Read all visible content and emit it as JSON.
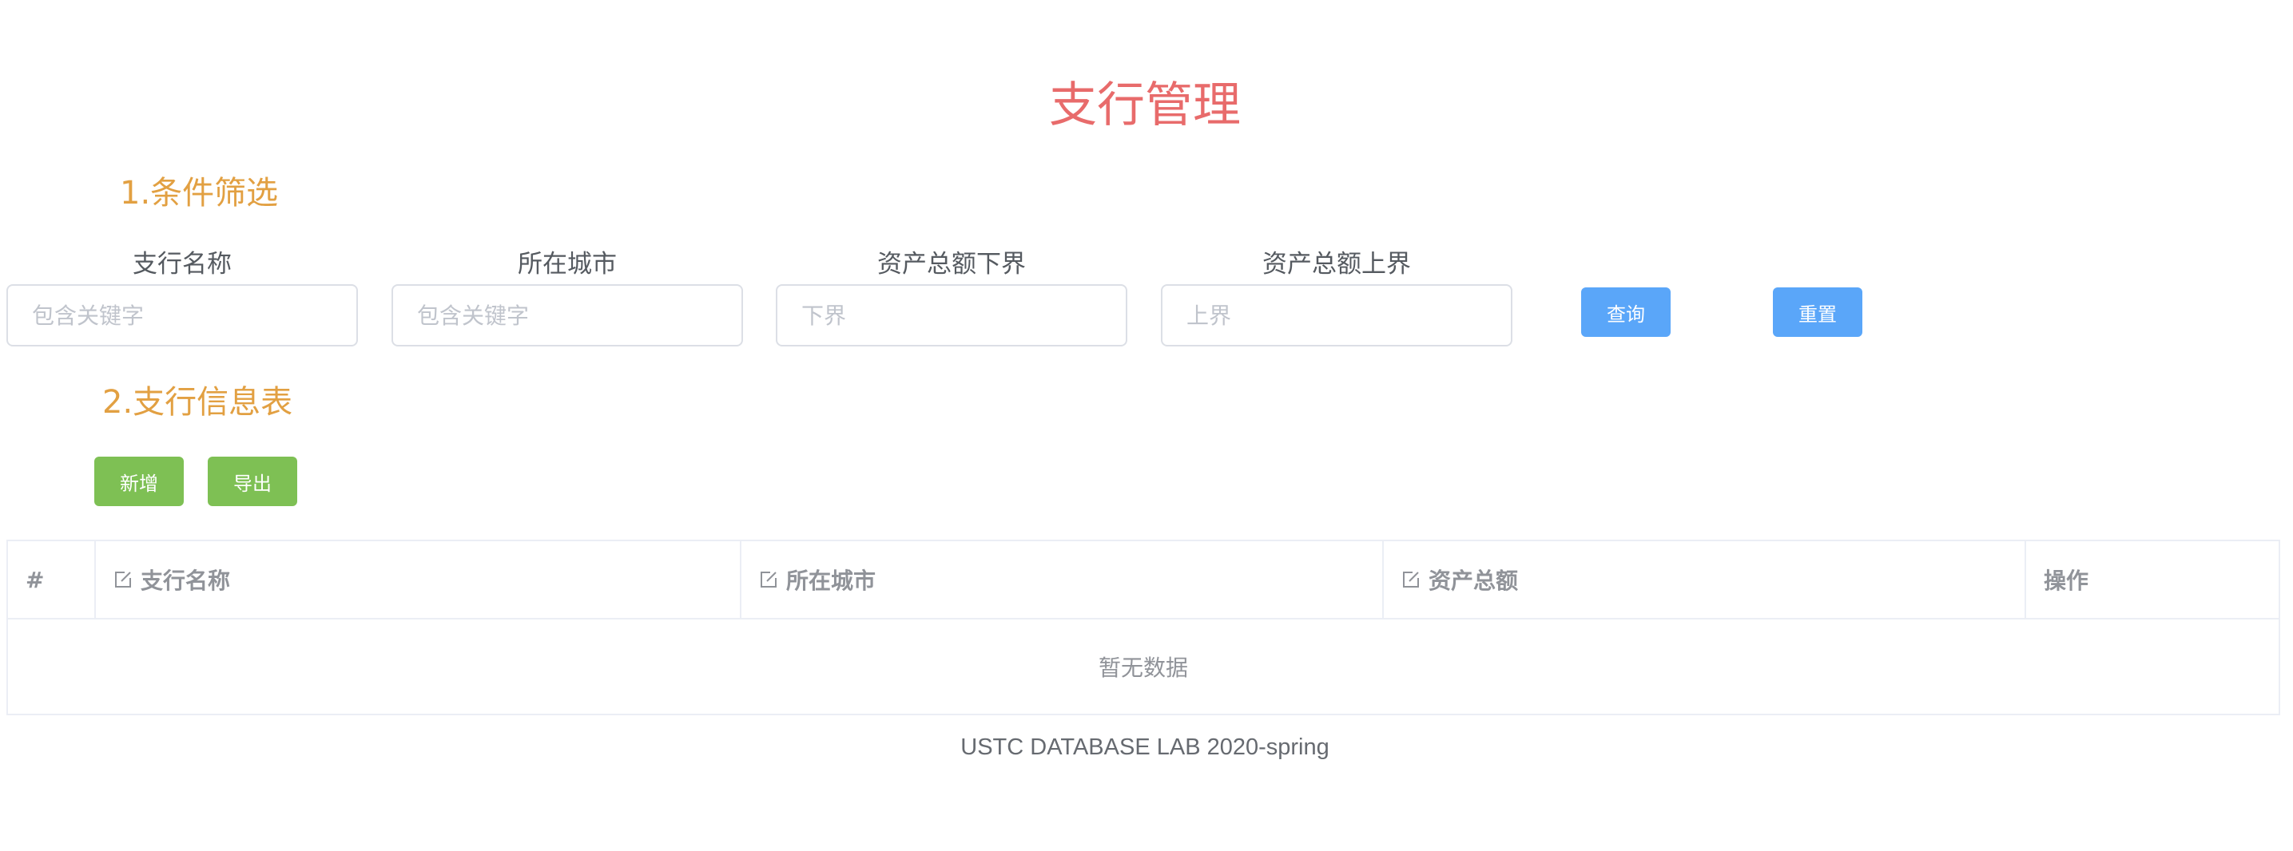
{
  "page": {
    "title": "支行管理"
  },
  "filter": {
    "section_title": "1.条件筛选",
    "fields": [
      {
        "label": "支行名称",
        "placeholder": "包含关键字"
      },
      {
        "label": "所在城市",
        "placeholder": "包含关键字"
      },
      {
        "label": "资产总额下界",
        "placeholder": "下界"
      },
      {
        "label": "资产总额上界",
        "placeholder": "上界"
      }
    ],
    "query_label": "查询",
    "reset_label": "重置",
    "button_color": "#5aa6f9"
  },
  "table_section": {
    "section_title": "2.支行信息表",
    "add_label": "新增",
    "export_label": "导出",
    "button_color": "#7ec054",
    "columns": [
      {
        "label": "#",
        "icon": null
      },
      {
        "label": "支行名称",
        "icon": "edit-icon"
      },
      {
        "label": "所在城市",
        "icon": "edit-icon"
      },
      {
        "label": "资产总额",
        "icon": "edit-icon"
      },
      {
        "label": "操作",
        "icon": null
      }
    ],
    "rows": [],
    "empty_text": "暂无数据"
  },
  "footer": {
    "text": "USTC DATABASE LAB 2020-spring"
  },
  "colors": {
    "title": "#e86b6b",
    "section_title": "#e2a042"
  }
}
